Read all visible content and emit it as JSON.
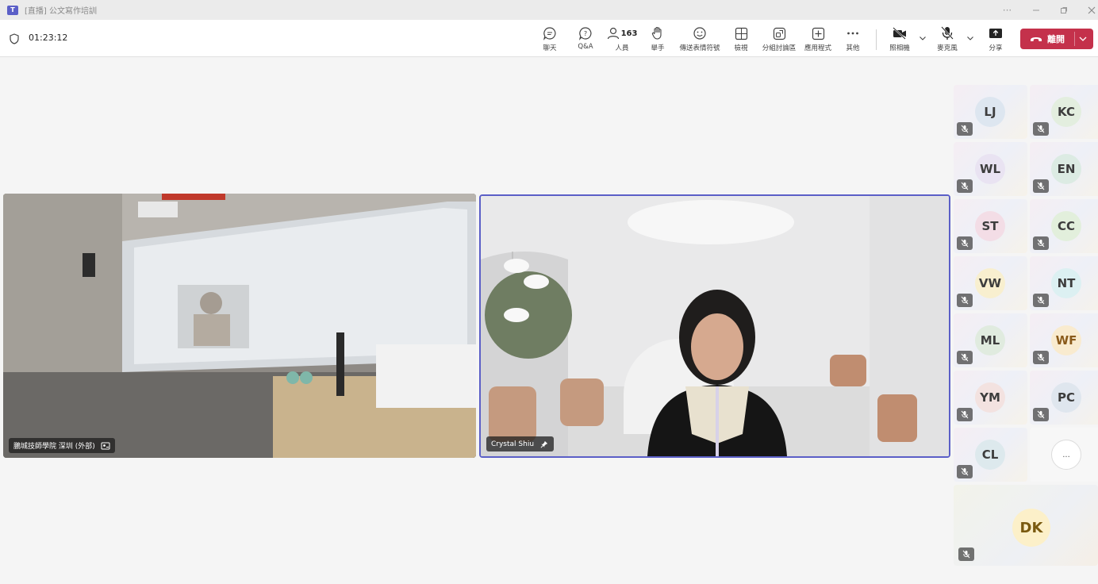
{
  "window": {
    "title": "[直播] 公文寫作培訓"
  },
  "toolbar": {
    "timer": "01:23:12",
    "chat_label": "聊天",
    "qa_label": "Q&A",
    "people_label": "人員",
    "people_count": "163",
    "raise_hand_label": "舉手",
    "reactions_label": "傳送表情符號",
    "view_label": "檢視",
    "breakout_label": "分組討論區",
    "apps_label": "應用程式",
    "more_label": "其他",
    "camera_label": "照相機",
    "mic_label": "麥克風",
    "share_label": "分享",
    "leave_label": "離開",
    "leave_color": "#c4314b"
  },
  "stage": {
    "room_tile_name": "鵬城技師學院 深圳 (外部)",
    "speaker_tile_name": "Crystal Shiu"
  },
  "roster": {
    "participants": [
      {
        "initials": "LJ",
        "muted": true,
        "color": "#dde6f0"
      },
      {
        "initials": "KC",
        "muted": true,
        "color": "#e3eedf"
      },
      {
        "initials": "WL",
        "muted": true,
        "color": "#e9e3f2"
      },
      {
        "initials": "EN",
        "muted": true,
        "color": "#dcebe3"
      },
      {
        "initials": "ST",
        "muted": true,
        "color": "#f3dde6"
      },
      {
        "initials": "CC",
        "muted": true,
        "color": "#e2efdc"
      },
      {
        "initials": "VW",
        "muted": true,
        "color": "#f8efcf"
      },
      {
        "initials": "NT",
        "muted": true,
        "color": "#dcf0f2"
      },
      {
        "initials": "ML",
        "muted": true,
        "color": "#e0ebdf"
      },
      {
        "initials": "WF",
        "muted": true,
        "color": "#f9ebcf"
      },
      {
        "initials": "YM",
        "muted": true,
        "color": "#f3e2e0"
      },
      {
        "initials": "PC",
        "muted": true,
        "color": "#dfe6ee"
      },
      {
        "initials": "CL",
        "muted": true,
        "color": "#dde9ed"
      }
    ],
    "more_label": "...",
    "big_tile": {
      "initials": "DK",
      "muted": true,
      "color": "#fcf0c9"
    }
  }
}
